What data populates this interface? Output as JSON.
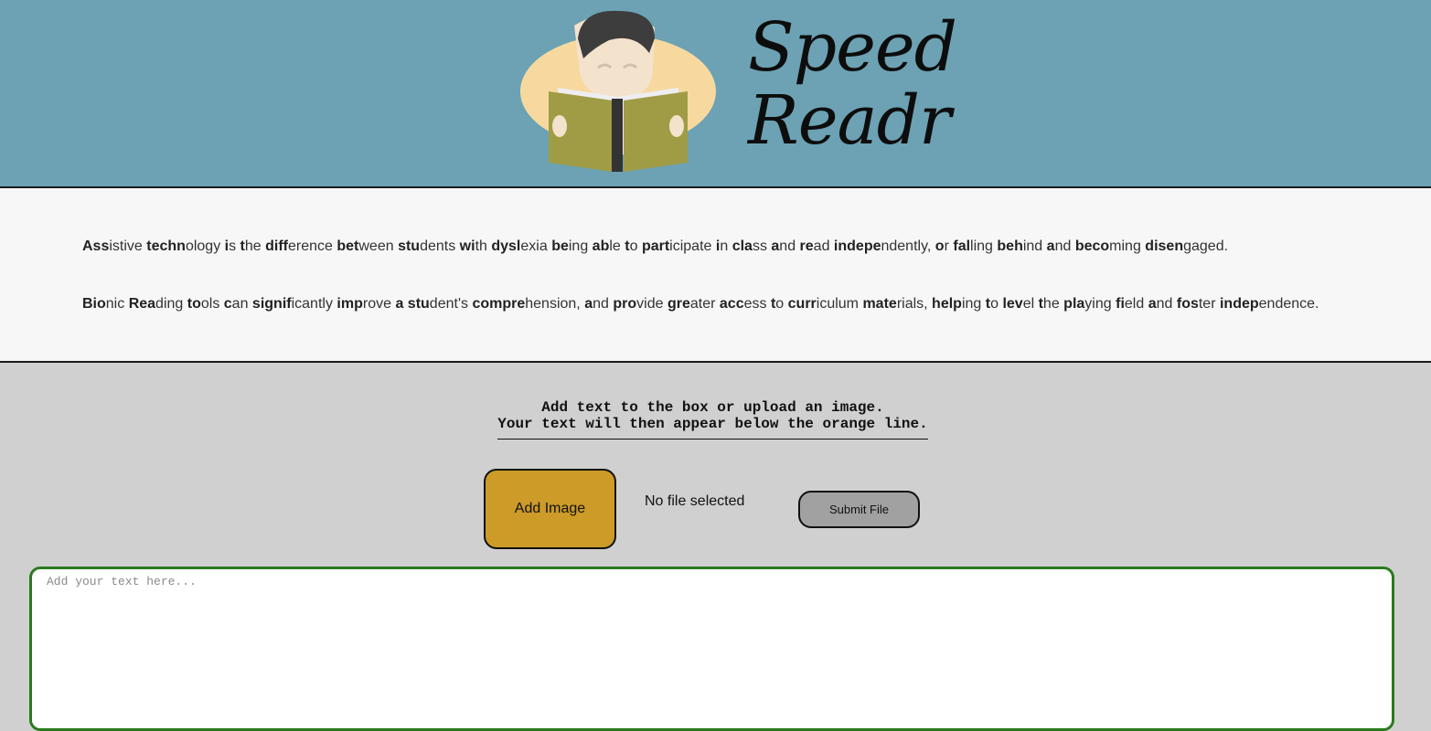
{
  "header": {
    "logo_line1": "Speed",
    "logo_line2": "Readr",
    "logo_image": "boy-reading-book-illustration"
  },
  "intro": {
    "paragraph1": [
      [
        "Ass",
        "istive"
      ],
      [
        "techn",
        "ology"
      ],
      [
        "i",
        "s"
      ],
      [
        "t",
        "he"
      ],
      [
        "diff",
        "erence"
      ],
      [
        "bet",
        "ween"
      ],
      [
        "stu",
        "dents"
      ],
      [
        "wi",
        "th"
      ],
      [
        "dysl",
        "exia"
      ],
      [
        "be",
        "ing"
      ],
      [
        "ab",
        "le"
      ],
      [
        "t",
        "o"
      ],
      [
        "part",
        "icipate"
      ],
      [
        "i",
        "n"
      ],
      [
        "cla",
        "ss"
      ],
      [
        "a",
        "nd"
      ],
      [
        "re",
        "ad"
      ],
      [
        "indepe",
        "ndently,"
      ],
      [
        "o",
        "r"
      ],
      [
        "fal",
        "ling"
      ],
      [
        "beh",
        "ind"
      ],
      [
        "a",
        "nd"
      ],
      [
        "beco",
        "ming"
      ],
      [
        "disen",
        "gaged."
      ]
    ],
    "paragraph2": [
      [
        "Bio",
        "nic"
      ],
      [
        "Rea",
        "ding"
      ],
      [
        "to",
        "ols"
      ],
      [
        "c",
        "an"
      ],
      [
        "signif",
        "icantly"
      ],
      [
        "imp",
        "rove"
      ],
      [
        "a",
        ""
      ],
      [
        "stu",
        "dent's"
      ],
      [
        "compre",
        "hension,"
      ],
      [
        "a",
        "nd"
      ],
      [
        "pro",
        "vide"
      ],
      [
        "gre",
        "ater"
      ],
      [
        "acc",
        "ess"
      ],
      [
        "t",
        "o"
      ],
      [
        "curr",
        "iculum"
      ],
      [
        "mate",
        "rials,"
      ],
      [
        "help",
        "ing"
      ],
      [
        "t",
        "o"
      ],
      [
        "lev",
        "el"
      ],
      [
        "t",
        "he"
      ],
      [
        "pla",
        "ying"
      ],
      [
        "fi",
        "eld"
      ],
      [
        "a",
        "nd"
      ],
      [
        "fos",
        "ter"
      ],
      [
        "indep",
        "endence."
      ]
    ]
  },
  "instructions": {
    "line1": "Add text to the box or upload an image.",
    "line2": "Your text will then appear below the orange line."
  },
  "controls": {
    "add_image_label": "Add Image",
    "file_status": "No file selected",
    "submit_label": "Submit File"
  },
  "textarea": {
    "placeholder": "Add your text here...",
    "value": ""
  },
  "colors": {
    "header_bg": "#6ca2b3",
    "intro_bg": "#f7f7f7",
    "page_bg": "#d0d0d0",
    "add_image_bg": "#cc9b28",
    "submit_bg": "#a1a1a1",
    "textbox_border": "#2a7a1e"
  }
}
